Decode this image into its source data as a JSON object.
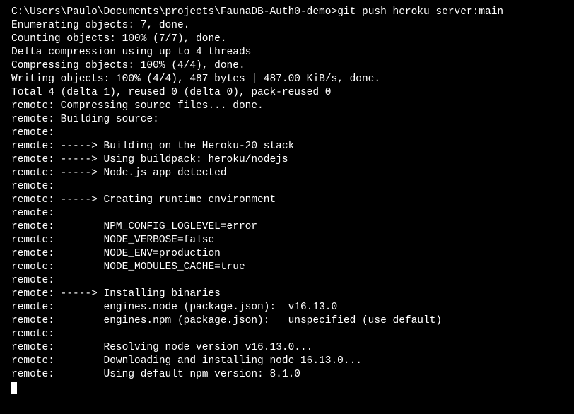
{
  "terminal": {
    "prompt": "C:\\Users\\Paulo\\Documents\\projects\\FaunaDB-Auth0-demo>",
    "command": "git push heroku server:main",
    "lines": [
      "Enumerating objects: 7, done.",
      "Counting objects: 100% (7/7), done.",
      "Delta compression using up to 4 threads",
      "Compressing objects: 100% (4/4), done.",
      "Writing objects: 100% (4/4), 487 bytes | 487.00 KiB/s, done.",
      "Total 4 (delta 1), reused 0 (delta 0), pack-reused 0",
      "remote: Compressing source files... done.",
      "remote: Building source:",
      "remote:",
      "remote: -----> Building on the Heroku-20 stack",
      "remote: -----> Using buildpack: heroku/nodejs",
      "remote: -----> Node.js app detected",
      "remote:",
      "remote: -----> Creating runtime environment",
      "remote:",
      "remote:        NPM_CONFIG_LOGLEVEL=error",
      "remote:        NODE_VERBOSE=false",
      "remote:        NODE_ENV=production",
      "remote:        NODE_MODULES_CACHE=true",
      "remote:",
      "remote: -----> Installing binaries",
      "remote:        engines.node (package.json):  v16.13.0",
      "remote:        engines.npm (package.json):   unspecified (use default)",
      "remote:",
      "remote:        Resolving node version v16.13.0...",
      "remote:        Downloading and installing node 16.13.0...",
      "remote:        Using default npm version: 8.1.0"
    ]
  }
}
